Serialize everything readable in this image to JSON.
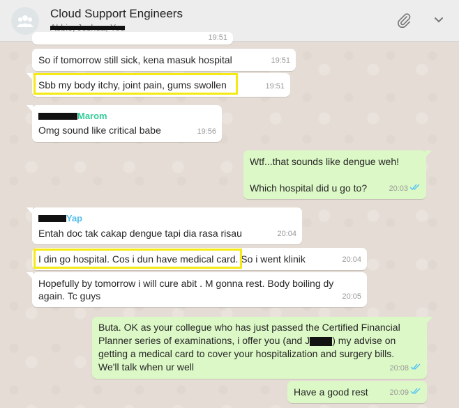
{
  "header": {
    "title": "Cloud Support Engineers",
    "subtitle": "Abbie, Joshua, You"
  },
  "messages": [
    {
      "text": "So if tomorrow still sick, kena masuk hospital",
      "time": "19:51"
    },
    {
      "text": "Sbb my body itchy, joint pain, gums swollen",
      "time": "19:51"
    },
    {
      "sender": "Marom",
      "text": "Omg sound like critical babe",
      "time": "19:56"
    },
    {
      "text_line1": "Wtf...that sounds like dengue weh!",
      "text_line2": "Which hospital did u go to?",
      "time": "20:03"
    },
    {
      "sender": "Yap",
      "text": "Entah doc tak cakap dengue tapi dia rasa risau",
      "time": "20:04"
    },
    {
      "text": "I din go hospital. Cos i dun have medical card.",
      "text_after": " So i went klinik",
      "time": "20:04"
    },
    {
      "text_line1": "Hopefully by tomorrow i will cure abit . M gonna rest. Body boiling dy",
      "text_line2": "again. Tc guys",
      "time": "20:05"
    },
    {
      "line1": "Buta. OK as your collegue who has just passed the Certified Financial",
      "line2a": "Planner series of examinations, i offer you (and J",
      "line2b": ") my advise on",
      "line3": "getting a medical card to cover your hospitalization and surgery bills.",
      "line4": "We'll talk when ur well",
      "time": "20:08"
    },
    {
      "text": "Have a good rest",
      "time": "20:09"
    }
  ],
  "colors": {
    "incoming": "#ffffff",
    "outgoing": "#dcf8c6",
    "highlight": "#f5ea13",
    "read_ticks": "#4fc3f7"
  },
  "icons": [
    "group-avatar-icon",
    "paperclip-icon",
    "chevron-down-icon",
    "double-check-icon"
  ]
}
